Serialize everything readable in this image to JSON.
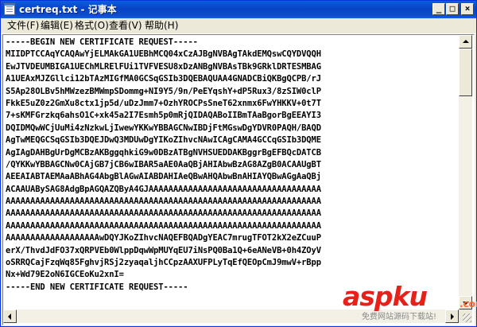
{
  "window": {
    "title": "certreq.txt - 记事本",
    "controls": {
      "minimize": "_",
      "maximize": "□",
      "close": "×"
    }
  },
  "menu": {
    "items": [
      {
        "label": "文件(F)"
      },
      {
        "label": "编辑(E)"
      },
      {
        "label": "格式(O)"
      },
      {
        "label": "查看(V)"
      },
      {
        "label": "帮助(H)"
      }
    ]
  },
  "editor": {
    "lines": [
      "-----BEGIN NEW CERTIFICATE REQUEST-----",
      "MIIDPTCCAqYCAQAwYjELMAkGA1UEBhMCQ04xCzAJBgNVBAgTAkdEMQswCQYDVQQH",
      "EwJTVDEUMBIGA1UEChMLRElFUi1TVFVESU8xDzANBgNVBAsTBk9GRklDRTESMBAG",
      "A1UEAxMJZGllci12bTAzMIGfMA0GCSqGSIb3DQEBAQUAA4GNADCBiQKBgQCPB/rJ",
      "S5Ap28OLBv5hMWzezBMWmpSDommg+NI9Y5/9n/PeEYqshY+dP5Rux3/8zSIW0clP",
      "FkkE5uZ0z2GmXu8ctx1jp5d/uDzJmm7+OzhYROCPsSneT62xnmx6FwYHKKV+0t7T",
      "7+sKMFGrzkq6ahsO1C+xk45a2I7Esmh5p0mRjQIDAQABoIIBmTAaBgorBgEEAYI3",
      "DQIDMQwWCjUuMi4zNzkwLjIwewYKKwYBBAGCNwIBDjFtMGswDgYDVR0PAQH/BAQD",
      "AgTwMEQGCSqGSIb3DQEJDwQ3MDUwDgYIKoZIhvcNAwICAgCAMA4GCCqGSIb3DQME",
      "AgIAgDAHBgUrDgMCBzAKBggqhkiG9w0DBzATBgNVHSUEDDAKBggrBgEFBQcDATCB",
      "/QYKKwYBBAGCNw0CAjGB7jCB6wIBAR5aAE0AaQBjAHIAbwBzAG8AZgB0ACAAUgBT",
      "AEEAIABTAEMAaABhAG4AbgBlAGwAIABDAHIAeQBwAHQAbwBnAHIAYQBwAGgAaQBj",
      "ACAAUABySAG8AdgBpAGQAZQByA4GJAAAAAAAAAAAAAAAAAAAAAAAAAAAAAAAAAAA",
      "AAAAAAAAAAAAAAAAAAAAAAAAAAAAAAAAAAAAAAAAAAAAAAAAAAAAAAAAAAAAAAAA",
      "AAAAAAAAAAAAAAAAAAAAAAAAAAAAAAAAAAAAAAAAAAAAAAAAAAAAAAAAAAAAAAAA",
      "AAAAAAAAAAAAAAAAAAAAAAAAAAAAAAAAAAAAAAAAAAAAAAAAAAAAAAAAAAAAAAAA",
      "AAAAAAAAAAAAAAAAAAAwDQYJKoZIhvcNAQEFBQADgYEAC7mrugTFOT2kX2eZCuuP",
      "erX/ThvdJdFO37xQRPVEb0WlppDqwWpMUYqEU7iNsPQ0Ba1Q+6eANeVB+0h4ZOyV",
      "oSRRQCajFzqWq85FghvjRSj2zyaqaljhCCpzAAXUFPLyTqEfQEOpCmJ9mwV+rBpp",
      "Nx+Wd79E2oN6IGCEoKu2xnI=",
      "-----END NEW CERTIFICATE REQUEST-----"
    ]
  },
  "watermark": {
    "logo": "aspku",
    "suffix": ".com",
    "subtitle": "免费网站源码下载站!"
  },
  "colors": {
    "titlebar": "#0843c4",
    "watermark_logo": "#e8201a"
  }
}
